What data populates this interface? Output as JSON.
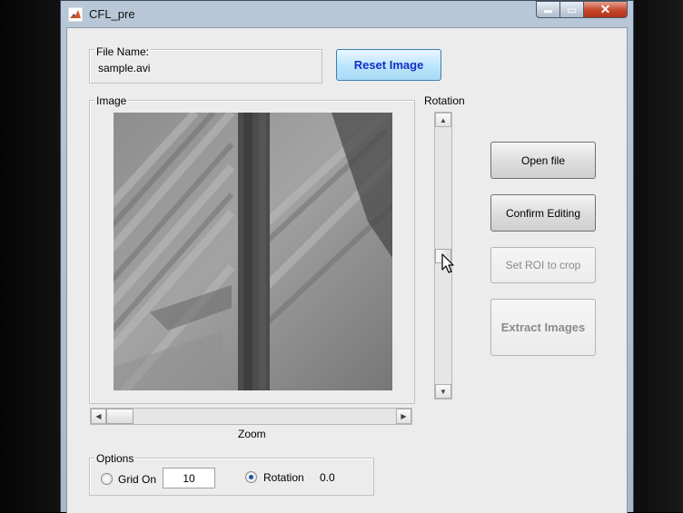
{
  "window": {
    "title": "CFL_pre",
    "min_glyph": "▬",
    "max_glyph": "▭",
    "close_glyph": "✕"
  },
  "file": {
    "label": "File Name:",
    "value": "sample.avi"
  },
  "buttons": {
    "reset": "Reset Image",
    "open": "Open file",
    "confirm": "Confirm Editing",
    "roi": "Set ROI to crop",
    "extract": "Extract Images"
  },
  "image_panel": {
    "label": "Image"
  },
  "rotation_slider": {
    "label": "Rotation",
    "level": 0.5
  },
  "zoom_slider": {
    "label": "Zoom",
    "level": 0.0
  },
  "options": {
    "label": "Options",
    "grid_label": "Grid On",
    "grid_checked": false,
    "grid_value": "10",
    "rotation_label": "Rotation",
    "rotation_checked": true,
    "rotation_value": "0.0"
  },
  "icons": {
    "app": "matlab-icon",
    "pointer": "arrow-cursor-icon"
  },
  "colors": {
    "reset_text": "#1431c5",
    "title_bar": "#b9c8d8"
  }
}
